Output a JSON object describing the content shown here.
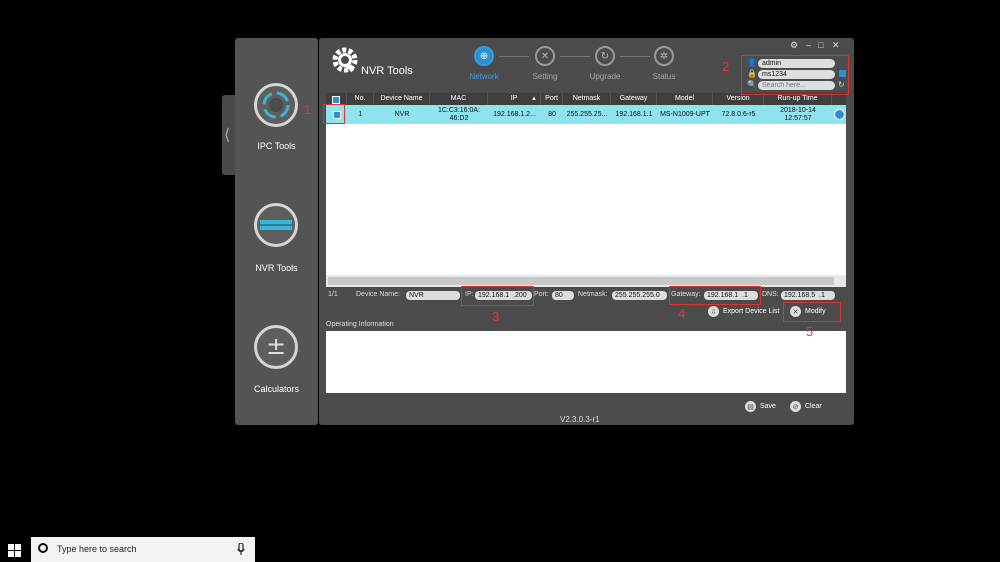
{
  "sidebar": {
    "tools": [
      {
        "label": "IPC Tools"
      },
      {
        "label": "NVR Tools"
      },
      {
        "label": "Calculators"
      }
    ]
  },
  "app": {
    "title": "NVR Tools",
    "version": "V2.3.0.3-r1"
  },
  "nav": {
    "items": [
      {
        "label": "Network",
        "active": true
      },
      {
        "label": "Setting"
      },
      {
        "label": "Upgrade"
      },
      {
        "label": "Status"
      }
    ]
  },
  "login": {
    "username": "admin",
    "password": "ms1234",
    "search_placeholder": "Search here..."
  },
  "table": {
    "columns": [
      "No.",
      "Device Name",
      "MAC",
      "IP",
      "Port",
      "Netmask",
      "Gateway",
      "Model",
      "Version",
      "Run-up Time"
    ],
    "rows": [
      {
        "no": "1",
        "device_name": "NVR",
        "mac_line1": "1C:C3:16:0A:",
        "mac_line2": "46:D2",
        "ip": "192.168.1.2...",
        "port": "80",
        "netmask": "255.255.25...",
        "gateway": "192.168.1.1",
        "model": "MS-N1009-UPT",
        "version": "72.8.0.6-r5",
        "runup_line1": "2018-10-14",
        "runup_line2": "12:57:57"
      }
    ]
  },
  "pager": "1/1",
  "edit": {
    "device_name_label": "Device Name:",
    "device_name": "NVR",
    "ip_label": "IP:",
    "ip": "192.168.1  .200",
    "port_label": "Port:",
    "port": "80",
    "netmask_label": "Netmask:",
    "netmask": "255.255.255.0",
    "gateway_label": "Gateway:",
    "gateway": "192.168.1  .1",
    "dns_label": "DNS:",
    "dns": "192.168.5  .1"
  },
  "actions": {
    "export": "Export Device List",
    "modify": "Modify",
    "save": "Save",
    "clear": "Clear"
  },
  "operating_info_label": "Operating Information",
  "annotations": [
    "1",
    "2",
    "3",
    "4",
    "5"
  ],
  "taskbar": {
    "search_placeholder": "Type here to search"
  },
  "colors": {
    "accent": "#2b8fd3",
    "selected_row": "#8fe3ef",
    "annotation": "#dd3333"
  }
}
